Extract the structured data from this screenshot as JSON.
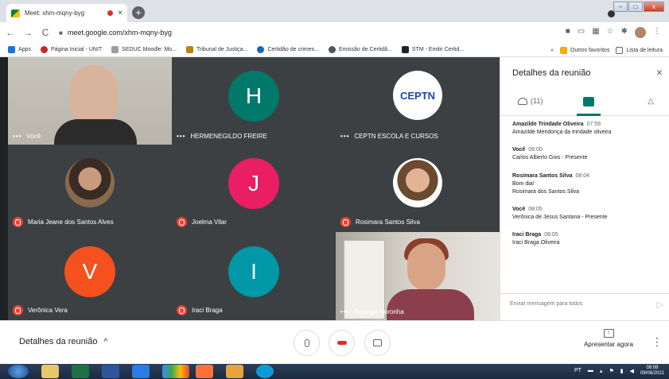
{
  "browser": {
    "tab_title": "Meet: xhm-mqny-byg",
    "tab_close": "×",
    "new_tab": "+",
    "url": "meet.google.com/xhm-mqny-byg",
    "bookmarks": [
      "Apps",
      "Página Inicial - UNIT",
      "SEDUC Moodle: Mo...",
      "Tribunal de Justiça...",
      "Certidão de crimes...",
      "Emissão de Certidã...",
      "STM - Emitir Certid..."
    ],
    "bookmarks_right": [
      "Outros favoritos",
      "Lista de leitura"
    ],
    "overflow": "»"
  },
  "participants": [
    {
      "name": "Você",
      "type": "video-you",
      "status": "dots"
    },
    {
      "name": "HERMENEGILDO FREIRE",
      "type": "letter",
      "letter": "H",
      "color": "#00796b",
      "status": "dots"
    },
    {
      "name": "CEPTN ESCOLA E CURSOS",
      "type": "logo",
      "logo_text": "CEPTN",
      "status": "dots"
    },
    {
      "name": "Maria Jeane dos Santos Alves",
      "type": "photo",
      "status": "muted"
    },
    {
      "name": "Joelma Vilar",
      "type": "letter",
      "letter": "J",
      "color": "#e91e63",
      "status": "muted"
    },
    {
      "name": "Rosimara Santos Silva",
      "type": "photo",
      "status": "muted"
    },
    {
      "name": "Verônica Vera",
      "type": "letter",
      "letter": "V",
      "color": "#f4511e",
      "status": "muted"
    },
    {
      "name": "Iraci Braga",
      "type": "letter",
      "letter": "I",
      "color": "#0097a7",
      "status": "muted"
    },
    {
      "name": "Solange Noronha",
      "type": "video",
      "status": "dots"
    }
  ],
  "panel": {
    "title": "Detalhes da reunião",
    "close": "×",
    "people_count": "(11)",
    "messages": [
      {
        "sender": "Amazilde Trindade Oliveira",
        "time": "07:59",
        "lines": [
          "Amazilde Mendonça da trindade oliveira"
        ]
      },
      {
        "sender": "Você",
        "time": "08:00",
        "lines": [
          "Carlos Alberto Gois - Presente"
        ]
      },
      {
        "sender": "Rosimara Santos Silva",
        "time": "08:04",
        "lines": [
          "Bom dia!",
          "Rosimara dos Santos Silva"
        ]
      },
      {
        "sender": "Você",
        "time": "08:05",
        "lines": [
          "Verônica de Jesus Santana - Presente"
        ]
      },
      {
        "sender": "Iraci Braga",
        "time": "08:05",
        "lines": [
          "Iraci Braga Oliveira"
        ]
      }
    ],
    "input_placeholder": "Enviar mensagem para todos"
  },
  "bottombar": {
    "details_label": "Detalhes da reunião",
    "present_label": "Apresentar agora"
  },
  "taskbar": {
    "lang": "PT",
    "time": "08:08",
    "date": "09/06/2021"
  },
  "colors": {
    "accent": "#00796b",
    "end_call": "#d93025",
    "stage_bg": "#202124"
  }
}
